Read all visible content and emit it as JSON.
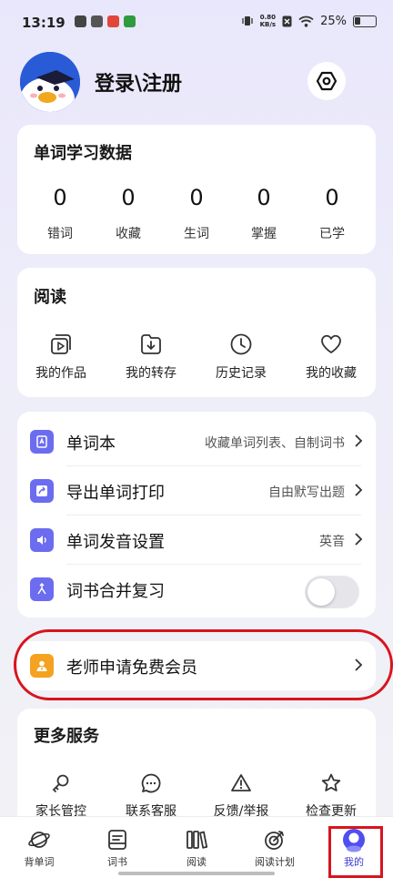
{
  "status_bar": {
    "time": "13:19",
    "net_speed_value": "0.80",
    "net_speed_unit": "KB/s",
    "battery": "25%"
  },
  "header": {
    "login_label": "登录\\注册"
  },
  "stats": {
    "title": "单词学习数据",
    "items": [
      {
        "value": "0",
        "label": "错词"
      },
      {
        "value": "0",
        "label": "收藏"
      },
      {
        "value": "0",
        "label": "生词"
      },
      {
        "value": "0",
        "label": "掌握"
      },
      {
        "value": "0",
        "label": "已学"
      }
    ]
  },
  "reading": {
    "title": "阅读",
    "items": [
      {
        "label": "我的作品",
        "icon": "works-icon"
      },
      {
        "label": "我的转存",
        "icon": "download-box-icon"
      },
      {
        "label": "历史记录",
        "icon": "clock-icon"
      },
      {
        "label": "我的收藏",
        "icon": "heart-icon"
      }
    ]
  },
  "list": {
    "items": [
      {
        "title": "单词本",
        "sub": "收藏单词列表、自制词书",
        "icon": "book-icon"
      },
      {
        "title": "导出单词打印",
        "sub": "自由默写出题",
        "icon": "export-icon"
      },
      {
        "title": "单词发音设置",
        "sub": "英音",
        "icon": "speaker-icon"
      },
      {
        "title": "词书合并复习",
        "sub": "",
        "icon": "merge-icon"
      }
    ]
  },
  "teacher": {
    "title": "老师申请免费会员",
    "icon": "teacher-icon"
  },
  "more": {
    "title": "更多服务",
    "items": [
      {
        "label": "家长管控",
        "icon": "key-icon"
      },
      {
        "label": "联系客服",
        "icon": "chat-icon"
      },
      {
        "label": "反馈/举报",
        "icon": "warning-icon"
      },
      {
        "label": "检查更新",
        "icon": "star-update-icon"
      }
    ]
  },
  "nav": {
    "items": [
      {
        "label": "背单词",
        "icon": "planet-icon"
      },
      {
        "label": "词书",
        "icon": "book-tray-icon"
      },
      {
        "label": "阅读",
        "icon": "bookshelf-icon"
      },
      {
        "label": "阅读计划",
        "icon": "target-icon"
      },
      {
        "label": "我的",
        "icon": "user-icon"
      }
    ],
    "active_color": "#3b3bd6"
  },
  "colors": {
    "accent": "#6c6cf0",
    "highlight": "#d8141e",
    "teacher_icon": "#f4a21f"
  }
}
